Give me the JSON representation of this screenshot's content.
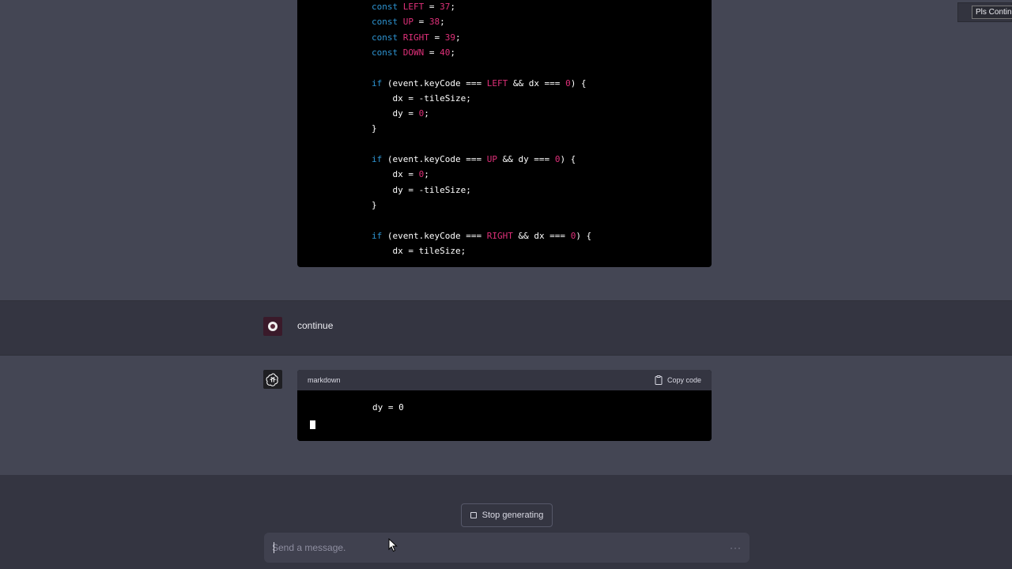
{
  "top_code": {
    "lines": [
      [
        {
          "t": "const ",
          "c": "kw"
        },
        {
          "t": "LEFT",
          "c": "cn"
        },
        {
          "t": " = "
        },
        {
          "t": "37",
          "c": "nm"
        },
        {
          "t": ";"
        }
      ],
      [
        {
          "t": "const ",
          "c": "kw"
        },
        {
          "t": "UP",
          "c": "cn"
        },
        {
          "t": " = "
        },
        {
          "t": "38",
          "c": "nm"
        },
        {
          "t": ";"
        }
      ],
      [
        {
          "t": "const ",
          "c": "kw"
        },
        {
          "t": "RIGHT",
          "c": "cn"
        },
        {
          "t": " = "
        },
        {
          "t": "39",
          "c": "nm"
        },
        {
          "t": ";"
        }
      ],
      [
        {
          "t": "const ",
          "c": "kw"
        },
        {
          "t": "DOWN",
          "c": "cn"
        },
        {
          "t": " = "
        },
        {
          "t": "40",
          "c": "nm"
        },
        {
          "t": ";"
        }
      ],
      [],
      [
        {
          "t": "if",
          "c": "kw"
        },
        {
          "t": " (event.keyCode === "
        },
        {
          "t": "LEFT",
          "c": "cn"
        },
        {
          "t": " && dx === "
        },
        {
          "t": "0",
          "c": "nm"
        },
        {
          "t": ") {"
        }
      ],
      [
        {
          "t": "    dx = -tileSize;"
        }
      ],
      [
        {
          "t": "    dy = "
        },
        {
          "t": "0",
          "c": "nm"
        },
        {
          "t": ";"
        }
      ],
      [
        {
          "t": "}"
        }
      ],
      [],
      [
        {
          "t": "if",
          "c": "kw"
        },
        {
          "t": " (event.keyCode === "
        },
        {
          "t": "UP",
          "c": "cn"
        },
        {
          "t": " && dy === "
        },
        {
          "t": "0",
          "c": "nm"
        },
        {
          "t": ") {"
        }
      ],
      [
        {
          "t": "    dx = "
        },
        {
          "t": "0",
          "c": "nm"
        },
        {
          "t": ";"
        }
      ],
      [
        {
          "t": "    dy = -tileSize;"
        }
      ],
      [
        {
          "t": "}"
        }
      ],
      [],
      [
        {
          "t": "if",
          "c": "kw"
        },
        {
          "t": " (event.keyCode === "
        },
        {
          "t": "RIGHT",
          "c": "cn"
        },
        {
          "t": " && dx === "
        },
        {
          "t": "0",
          "c": "nm"
        },
        {
          "t": ") {"
        }
      ],
      [
        {
          "t": "    dx = tileSize;"
        }
      ]
    ]
  },
  "user_message": {
    "text": "continue"
  },
  "assistant_message": {
    "code_language": "markdown",
    "copy_label": "Copy code",
    "code_text": "dy = 0"
  },
  "stop_button": {
    "label": "Stop generating"
  },
  "composer": {
    "placeholder": "Send a message.",
    "value": "",
    "more_icon": "ellipsis-icon"
  },
  "corner_button": {
    "label": "Pls Continue"
  },
  "colors": {
    "keyword": "#2e95d3",
    "constant": "#df3079",
    "page_bg": "#444654",
    "user_row_bg": "#343541"
  }
}
